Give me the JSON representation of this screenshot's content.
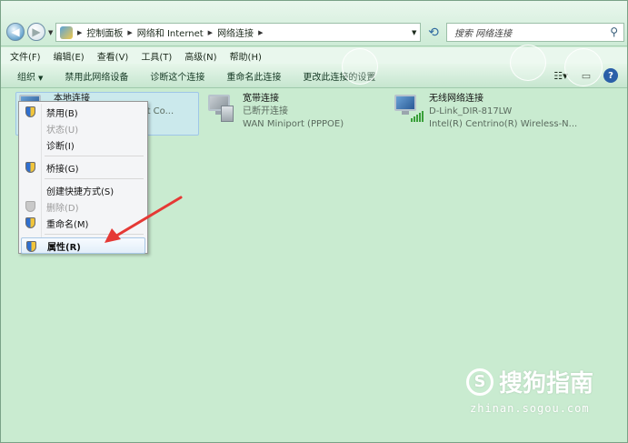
{
  "address": {
    "crumbs": [
      "控制面板",
      "网络和 Internet",
      "网络连接"
    ],
    "search_placeholder": "搜索 网络连接"
  },
  "menubar": [
    "文件(F)",
    "编辑(E)",
    "查看(V)",
    "工具(T)",
    "高级(N)",
    "帮助(H)"
  ],
  "toolbar": {
    "organize": "组织",
    "disable": "禁用此网络设备",
    "diagnose": "诊断这个连接",
    "rename": "重命名此连接",
    "change": "更改此连接的设置"
  },
  "connections": [
    {
      "name": "本地连接",
      "status": "",
      "device": "ernet Co..."
    },
    {
      "name": "宽带连接",
      "status": "已断开连接",
      "device": "WAN Miniport (PPPOE)"
    },
    {
      "name": "无线网络连接",
      "status": "D-Link_DIR-817LW",
      "device": "Intel(R) Centrino(R) Wireless-N..."
    }
  ],
  "context_menu": {
    "disable": "禁用(B)",
    "status": "状态(U)",
    "diagnose": "诊断(I)",
    "bridge": "桥接(G)",
    "shortcut": "创建快捷方式(S)",
    "delete": "删除(D)",
    "rename": "重命名(M)",
    "properties": "属性(R)"
  },
  "watermark": {
    "brand": "搜狗指南",
    "url": "zhinan.sogou.com"
  },
  "colors": {
    "background": "#c9ebd0",
    "arrow": "#e53935"
  }
}
